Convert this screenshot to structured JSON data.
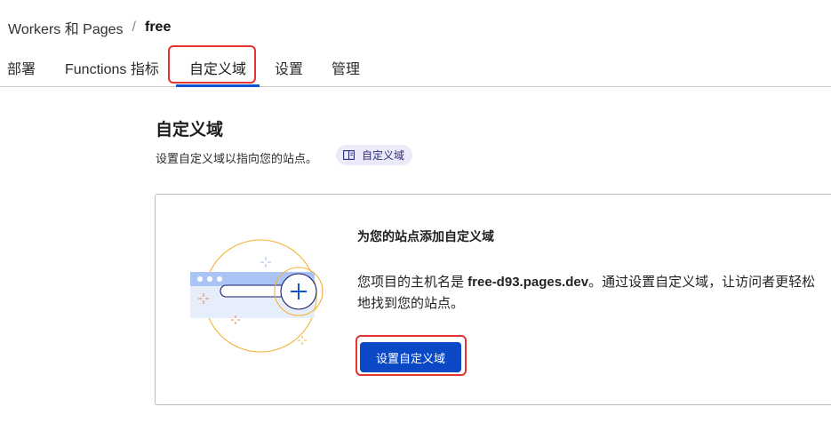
{
  "breadcrumb": {
    "parent": "Workers 和 Pages",
    "separator": "/",
    "current": "free"
  },
  "tabs": [
    {
      "label": "部署"
    },
    {
      "label": "Functions 指标"
    },
    {
      "label": "自定义域"
    },
    {
      "label": "设置"
    },
    {
      "label": "管理"
    }
  ],
  "active_tab": "自定义域",
  "section": {
    "title": "自定义域",
    "description": "设置自定义域以指向您的站点。",
    "doc_badge": {
      "icon": "book-icon",
      "label": "自定义域"
    }
  },
  "card": {
    "title": "为您的站点添加自定义域",
    "desc_before": "您项目的主机名是 ",
    "hostname": "free-d93.pages.dev",
    "desc_after": "。通过设置自定义域，让访问者更轻松地找到您的站点。",
    "button_label": "设置自定义域",
    "illustration_icon": "browser-add-domain-icon"
  },
  "colors": {
    "accent": "#0a48c6",
    "highlight": "#e3342f",
    "badge_bg": "#eceaf8",
    "illustration_orange": "#f2b233",
    "illustration_blue": "#a9c4f5"
  }
}
